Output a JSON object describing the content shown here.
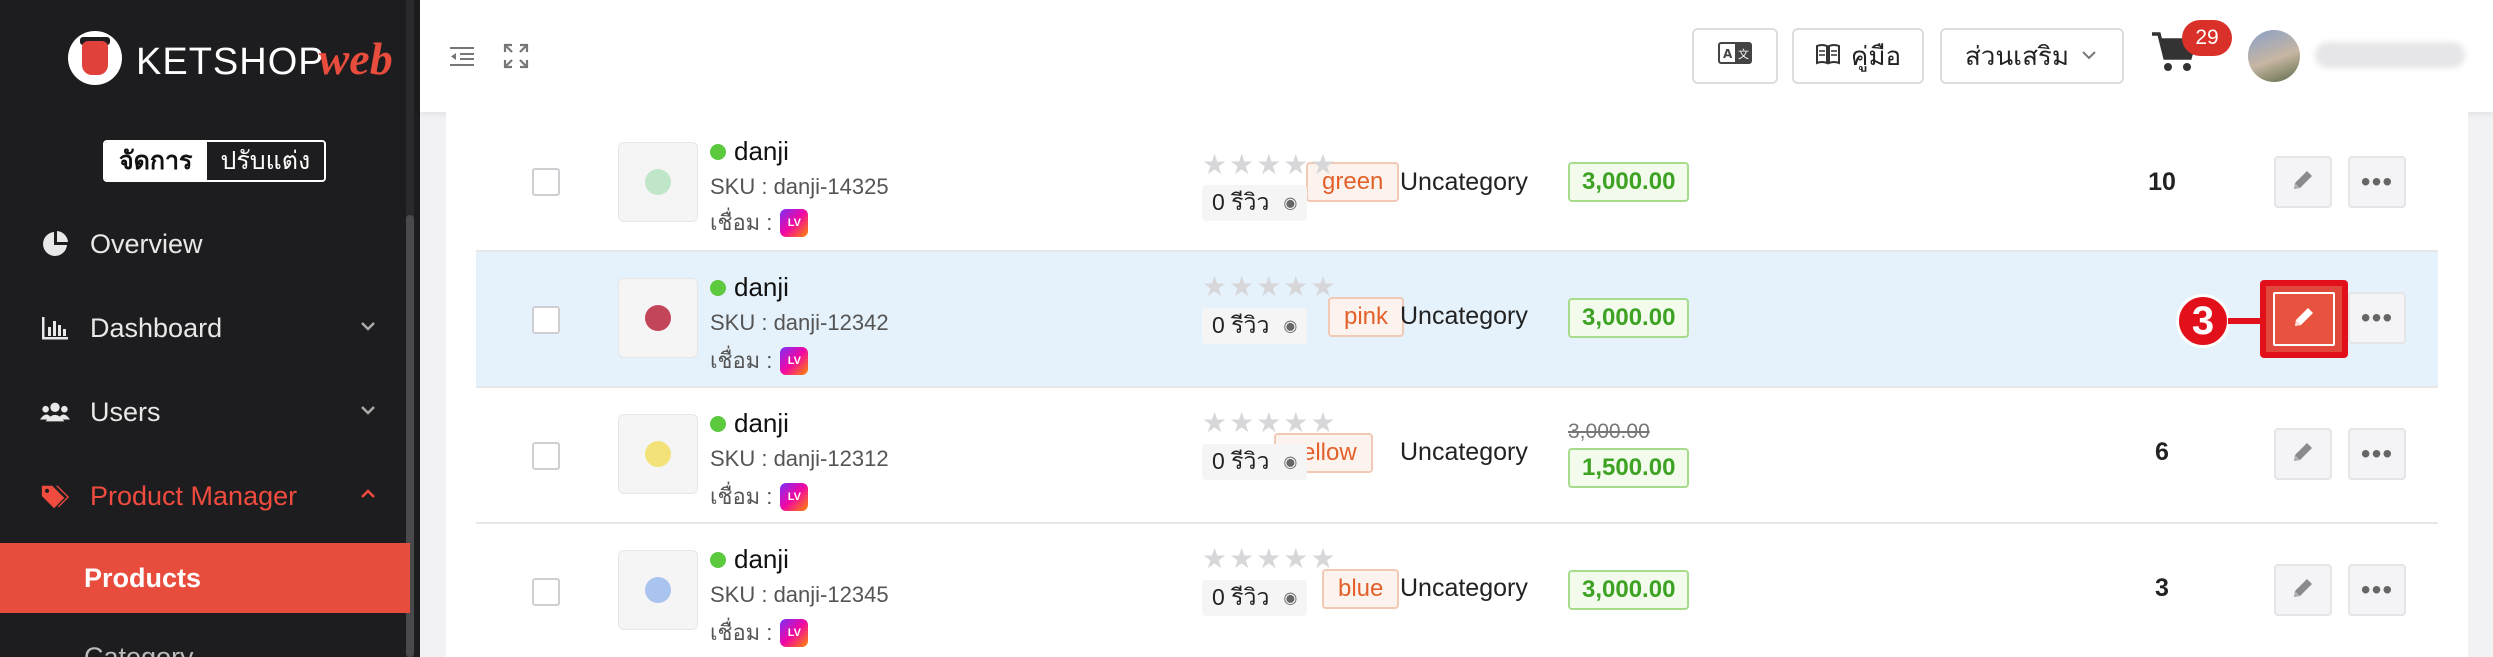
{
  "brand": {
    "name": "KETSHOP",
    "suffix": "web"
  },
  "mode_switch": {
    "active": "จัดการ",
    "inactive": "ปรับแต่ง"
  },
  "sidebar": {
    "items": [
      {
        "label": "Overview",
        "icon": "pie-chart-icon"
      },
      {
        "label": "Dashboard",
        "icon": "bar-chart-icon"
      },
      {
        "label": "Users",
        "icon": "users-icon"
      },
      {
        "label": "Product Manager",
        "icon": "tag-icon"
      }
    ],
    "sub_items": [
      "Products",
      "Category"
    ]
  },
  "header": {
    "translate_label": "A文",
    "manual_label": "คู่มือ",
    "addons_label": "ส่วนเสริม",
    "cart_count": "29"
  },
  "products": [
    {
      "name": "danji",
      "sku": "SKU : danji-14325",
      "link_label": "เชื่อม :",
      "variant": "green",
      "stars": "★★★★★",
      "reviews": "0 รีวิว",
      "category": "Uncategory",
      "old_price": "",
      "price": "3,000.00",
      "stock": "10",
      "ball_color": "#bfe6c9"
    },
    {
      "name": "danji",
      "sku": "SKU : danji-12342",
      "link_label": "เชื่อม :",
      "variant": "pink",
      "stars": "★★★★★",
      "reviews": "0 รีวิว",
      "category": "Uncategory",
      "old_price": "",
      "price": "3,000.00",
      "stock": "",
      "ball_color": "#c2455a"
    },
    {
      "name": "danji",
      "sku": "SKU : danji-12312",
      "link_label": "เชื่อม :",
      "variant": "yellow",
      "stars": "★★★★★",
      "reviews": "0 รีวิว",
      "category": "Uncategory",
      "old_price": "3,000.00",
      "price": "1,500.00",
      "stock": "6",
      "ball_color": "#f3e27a"
    },
    {
      "name": "danji",
      "sku": "SKU : danji-12345",
      "link_label": "เชื่อม :",
      "variant": "blue",
      "stars": "★★★★★",
      "reviews": "0 รีวิว",
      "category": "Uncategory",
      "old_price": "",
      "price": "3,000.00",
      "stock": "3",
      "ball_color": "#a9c4ee"
    }
  ],
  "annotation": {
    "step": "3"
  },
  "colors": {
    "accent": "#e74c3c",
    "sidebar_bg": "#1d1d1f",
    "price_green": "#3ea324",
    "variant_orange": "#e2612a",
    "highlight_row": "#e5f2fb"
  }
}
